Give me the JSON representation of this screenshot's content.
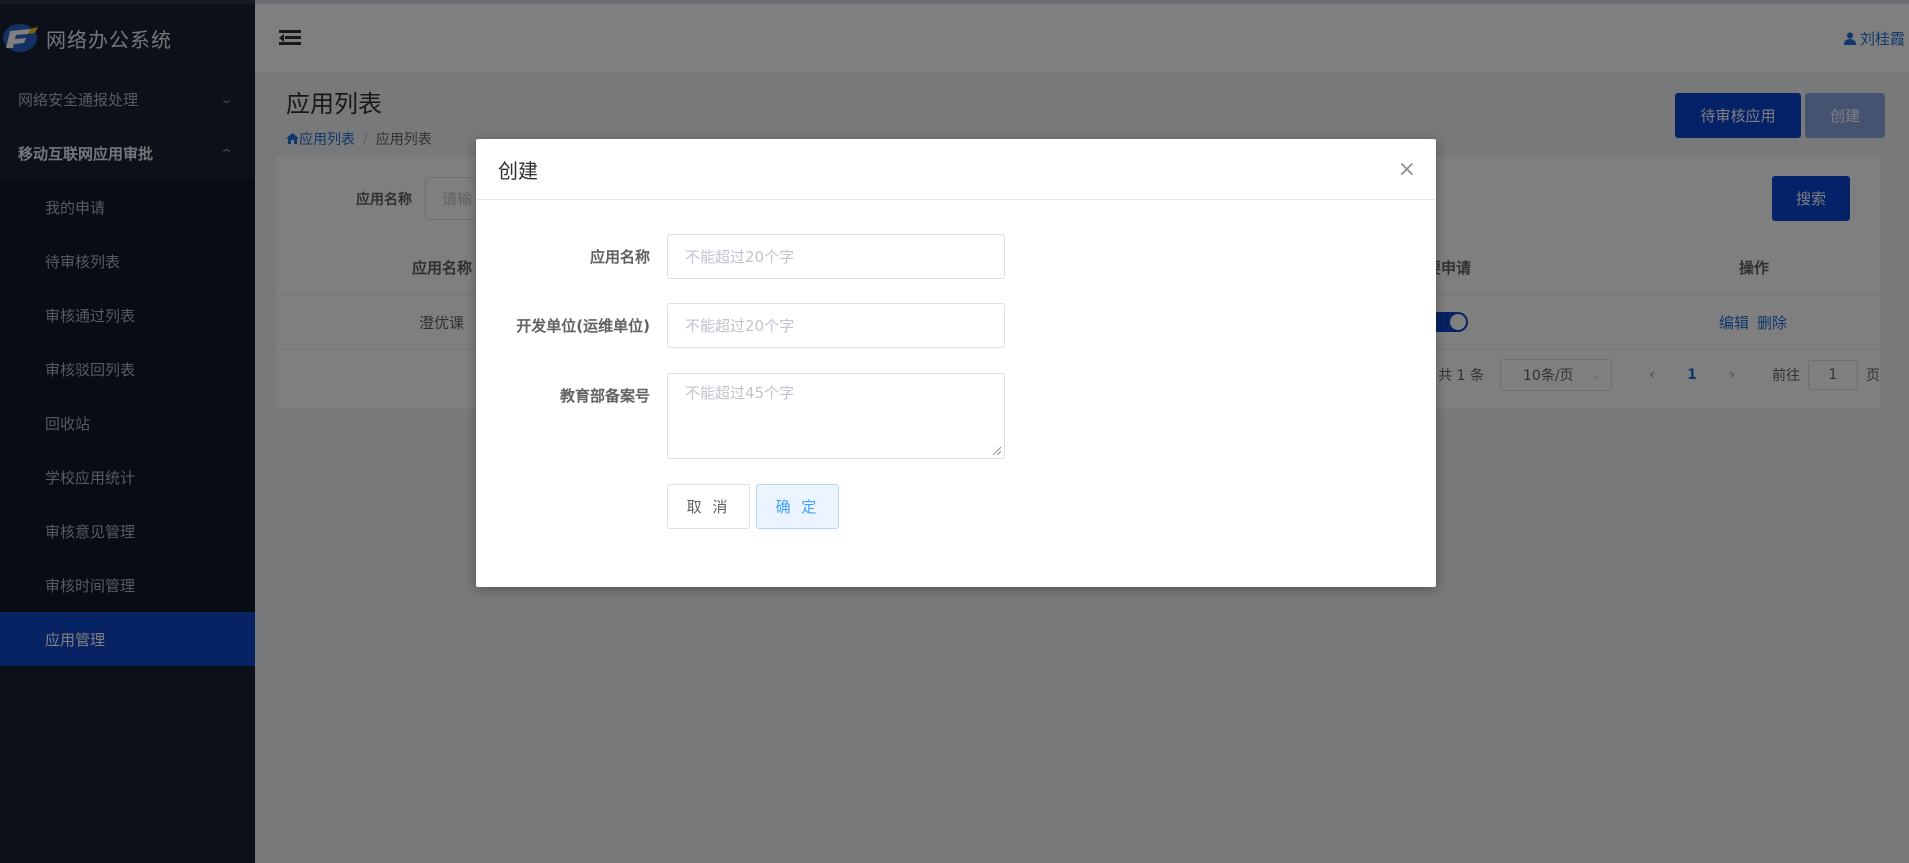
{
  "app": {
    "title": "网络办公系统",
    "colors": {
      "sidebar_bg": "#182232",
      "active": "#1047c8",
      "primary": "#0a45d0",
      "link": "#1f6fd6"
    }
  },
  "sidebar": {
    "groups": [
      {
        "label": "网络安全通报处理",
        "expanded": false
      },
      {
        "label": "移动互联网应用审批",
        "expanded": true
      }
    ],
    "items": [
      {
        "label": "我的申请"
      },
      {
        "label": "待审核列表"
      },
      {
        "label": "审核通过列表"
      },
      {
        "label": "审核驳回列表"
      },
      {
        "label": "回收站"
      },
      {
        "label": "学校应用统计"
      },
      {
        "label": "审核意见管理"
      },
      {
        "label": "审核时间管理"
      },
      {
        "label": "应用管理",
        "active": true
      }
    ]
  },
  "topbar": {
    "menu_icon": "hamburger-icon",
    "user": "刘桂霞",
    "user_icon": "user-icon"
  },
  "page": {
    "title": "应用列表",
    "breadcrumb": [
      "应用列表",
      "应用列表"
    ],
    "breadcrumb_icon": "home-icon",
    "actions": {
      "pending": "待审核应用",
      "create": "创建"
    }
  },
  "search": {
    "label": "应用名称",
    "placeholder": "请输",
    "button": "搜索"
  },
  "table": {
    "headers": {
      "name": "应用名称",
      "apply": "要申请",
      "ops": "操作"
    },
    "rows": [
      {
        "name": "澄优课",
        "switch_on": true,
        "edit": "编辑",
        "delete": "删除"
      }
    ]
  },
  "pagination": {
    "total": "共 1 条",
    "page_size": "10条/页",
    "current": "1",
    "goto_label": "前往",
    "goto_value": "1",
    "goto_suffix": "页"
  },
  "modal": {
    "title": "创建",
    "fields": {
      "name": {
        "label": "应用名称",
        "placeholder": "不能超过20个字"
      },
      "developer": {
        "label": "开发单位(运维单位)",
        "placeholder": "不能超过20个字"
      },
      "record": {
        "label": "教育部备案号",
        "placeholder": "不能超过45个字"
      }
    },
    "cancel": "取 消",
    "confirm": "确 定"
  }
}
